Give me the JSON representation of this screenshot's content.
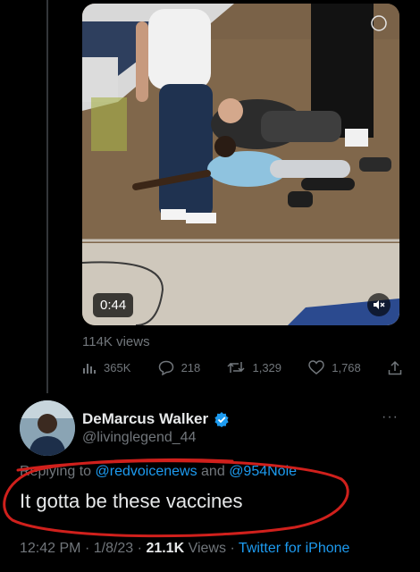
{
  "media": {
    "duration": "0:44",
    "mute_icon": "speaker-muted-icon"
  },
  "stats": {
    "views": "114K views",
    "analytics": "365K",
    "replies": "218",
    "retweets": "1,329",
    "likes": "1,768"
  },
  "reply": {
    "display_name": "DeMarcus Walker",
    "handle": "@livinglegend_44",
    "verified_color": "#1d9bf0",
    "replying_prefix": "Replying to",
    "mention_1": "@redvoicenews",
    "conjunction": "and",
    "mention_2": "@954Nole",
    "text": "It gotta be these vaccines",
    "time": "12:42 PM",
    "date": "1/8/23",
    "views_count": "21.1K",
    "views_label": "Views",
    "source": "Twitter for iPhone",
    "separator": "·"
  },
  "colors": {
    "background": "#000000",
    "muted": "#71767b",
    "link": "#1d9bf0",
    "annotation": "#d0201c"
  }
}
